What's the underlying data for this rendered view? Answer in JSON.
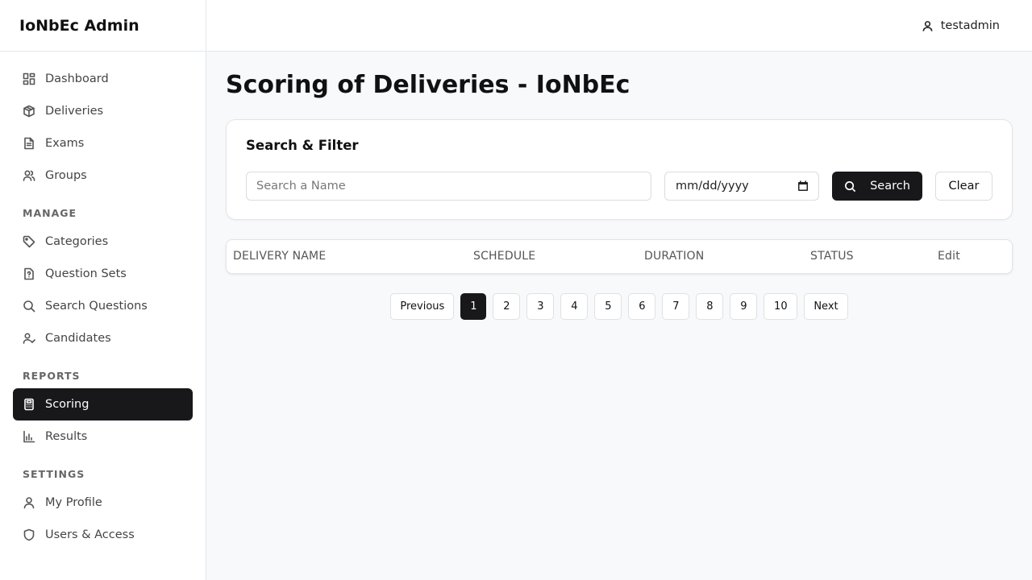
{
  "brand": "IoNbEc Admin",
  "user": {
    "name": "testadmin",
    "icon": "user-icon"
  },
  "sidebar": {
    "main_items": [
      {
        "label": "Dashboard",
        "icon": "dashboard-icon"
      },
      {
        "label": "Deliveries",
        "icon": "box-icon"
      },
      {
        "label": "Exams",
        "icon": "file-icon"
      },
      {
        "label": "Groups",
        "icon": "users-icon"
      }
    ],
    "manage_label": "MANAGE",
    "manage_items": [
      {
        "label": "Categories",
        "icon": "tag-icon"
      },
      {
        "label": "Question Sets",
        "icon": "question-file-icon"
      },
      {
        "label": "Search Questions",
        "icon": "search-icon"
      },
      {
        "label": "Candidates",
        "icon": "user-check-icon"
      }
    ],
    "reports_label": "REPORTS",
    "reports_items": [
      {
        "label": "Scoring",
        "icon": "calculator-icon",
        "active": true
      },
      {
        "label": "Results",
        "icon": "bar-chart-icon"
      }
    ],
    "settings_label": "SETTINGS",
    "settings_items": [
      {
        "label": "My Profile",
        "icon": "user-icon"
      },
      {
        "label": "Users & Access",
        "icon": "shield-icon"
      }
    ]
  },
  "page": {
    "title": "Scoring of Deliveries - IoNbEc"
  },
  "filter": {
    "title": "Search & Filter",
    "search_placeholder": "Search a Name",
    "search_value": "",
    "date_placeholder": "mm/dd/yyyy",
    "search_button": "Search",
    "clear_button": "Clear"
  },
  "table": {
    "columns": [
      "DELIVERY NAME",
      "SCHEDULE",
      "DURATION",
      "STATUS",
      "Edit"
    ],
    "rows": []
  },
  "pagination": {
    "previous": "Previous",
    "next": "Next",
    "pages": [
      "1",
      "2",
      "3",
      "4",
      "5",
      "6",
      "7",
      "8",
      "9",
      "10"
    ],
    "current": "1"
  },
  "colors": {
    "accent": "#18181b",
    "background": "#f8f9fb",
    "border": "#e4e6ea"
  }
}
